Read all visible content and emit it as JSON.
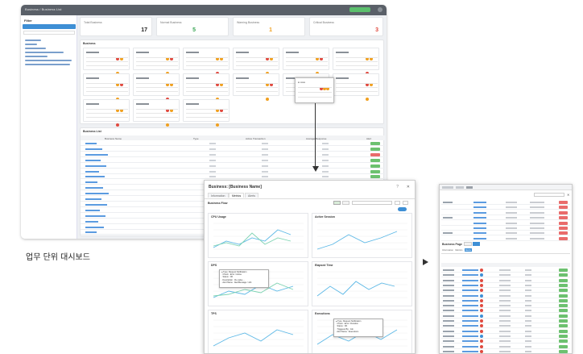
{
  "dashboard": {
    "breadcrumb": "Business / Business List",
    "sidebar_title": "Filter",
    "summary": [
      {
        "title": "Total Business",
        "value": "17",
        "color": "#222222"
      },
      {
        "title": "Normal Business",
        "value": "5",
        "color": "#3aa655"
      },
      {
        "title": "Warning Business",
        "value": "1",
        "color": "#f0a020"
      },
      {
        "title": "Critical Business",
        "value": "3",
        "color": "#e04a3f"
      }
    ],
    "section_label": "Business",
    "list_label": "Business List",
    "table_headers": [
      "Business Name",
      "Type",
      "Active Transaction",
      "Average Response",
      "Alert"
    ]
  },
  "caption": "업무 단위 대시보드",
  "modal": {
    "title": "Business: [Business Name]",
    "tabs": [
      "Information",
      "Metrics",
      "Alerts"
    ],
    "subtitle": "Business Flow",
    "charts": [
      {
        "title": "CPU Usage"
      },
      {
        "title": "Active Session"
      },
      {
        "title": "DPS"
      },
      {
        "title": "Elapsed Time"
      },
      {
        "title": "TPS"
      },
      {
        "title": "Executions"
      }
    ]
  },
  "detail": {
    "header_label": "Business Page",
    "tabs": [
      "Information",
      "Metrics",
      "Alerts"
    ]
  }
}
